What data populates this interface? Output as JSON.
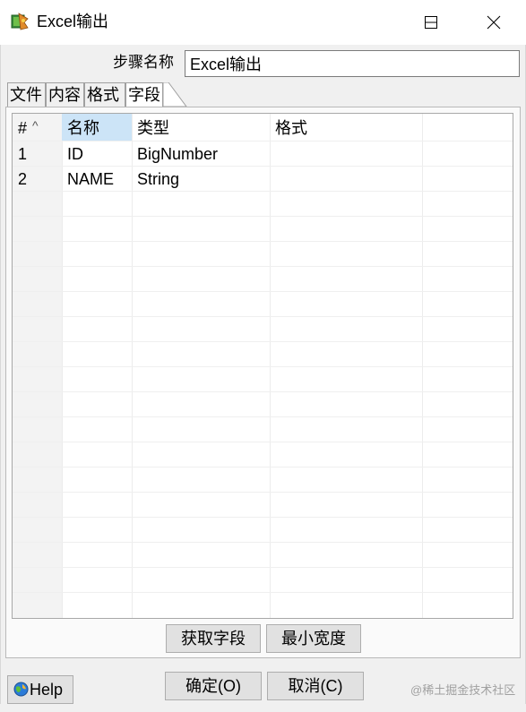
{
  "window": {
    "title": "Excel输出",
    "icon": "kettle-step-icon"
  },
  "window_controls": {
    "minimize": "minimize-icon",
    "maximize": "maximize-icon",
    "close": "close-icon"
  },
  "step": {
    "label": "步骤名称",
    "value": "Excel输出"
  },
  "tabs": [
    {
      "label": "文件",
      "active": false
    },
    {
      "label": "内容",
      "active": false
    },
    {
      "label": "格式",
      "active": false
    },
    {
      "label": "字段",
      "active": true
    }
  ],
  "table": {
    "columns": [
      "#",
      "名称",
      "类型",
      "格式"
    ],
    "rows": [
      [
        "1",
        "ID",
        "BigNumber",
        ""
      ],
      [
        "2",
        "NAME",
        "String",
        ""
      ]
    ]
  },
  "buttons": {
    "get_fields": "获取字段",
    "min_width": "最小宽度",
    "ok": "确定(O)",
    "cancel": "取消(C)",
    "help": "Help"
  },
  "watermark": "@稀土掘金技术社区",
  "colors": {
    "selected_header": "#cce4f7",
    "button_bg": "#e1e1e1",
    "dialog_bg": "#f0f0f0"
  }
}
